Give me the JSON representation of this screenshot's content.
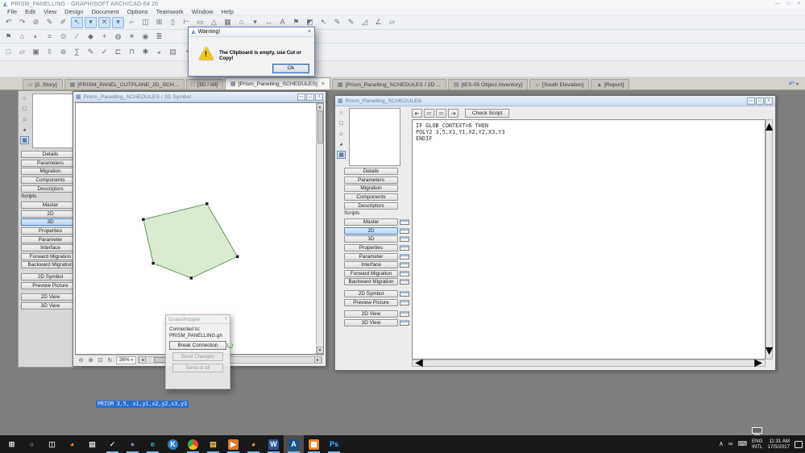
{
  "app": {
    "title": "PRISM_PANELLING - GRAPHISOFT ARCHICAD-64 20",
    "menu": [
      {
        "n": "menu-file",
        "label": "File"
      },
      {
        "n": "menu-edit",
        "label": "Edit"
      },
      {
        "n": "menu-view",
        "label": "View"
      },
      {
        "n": "menu-design",
        "label": "Design"
      },
      {
        "n": "menu-document",
        "label": "Document"
      },
      {
        "n": "menu-options",
        "label": "Options"
      },
      {
        "n": "menu-teamwork",
        "label": "Teamwork"
      },
      {
        "n": "menu-window",
        "label": "Window"
      },
      {
        "n": "menu-help",
        "label": "Help"
      }
    ]
  },
  "ui_glyphs": {
    "min": "—",
    "max": "□",
    "close": "×",
    "caret": "▾",
    "up": "▲",
    "down": "▼",
    "left": "◄",
    "right": "►",
    "history": "↶"
  },
  "toolbars": {
    "row1": [
      {
        "n": "undo-icon",
        "g": "↶"
      },
      {
        "n": "redo-icon",
        "g": "↷"
      },
      {
        "n": "suspend-groups-icon",
        "g": "⊘"
      },
      {
        "n": "pick-up-parameters-icon",
        "g": "✎"
      },
      {
        "n": "inject-parameters-icon",
        "g": "✐"
      },
      {
        "n": "arrow-tool",
        "g": "↖",
        "sel": true
      },
      {
        "n": "arrow-tool-dropdown",
        "g": "▾",
        "sel": true
      },
      {
        "n": "marquee-tool",
        "g": "✕",
        "sel": true
      },
      {
        "n": "marquee-tool-dropdown",
        "g": "▾",
        "sel": true
      },
      {
        "n": "wall-tool",
        "g": "⌐"
      },
      {
        "n": "door-tool",
        "g": "◫"
      },
      {
        "n": "window-tool",
        "g": "⊞"
      },
      {
        "n": "column-tool",
        "g": "▯"
      },
      {
        "n": "beam-tool",
        "g": "⊢"
      },
      {
        "n": "slab-tool",
        "g": "▭"
      },
      {
        "n": "roof-tool",
        "g": "△"
      },
      {
        "n": "mesh-tool",
        "g": "▦"
      },
      {
        "n": "object-tool",
        "g": "⌂"
      },
      {
        "n": "object-tool-dropdown",
        "g": "▾"
      },
      {
        "n": "dimension-tool",
        "g": "↔"
      },
      {
        "n": "text-tool",
        "g": "A"
      },
      {
        "n": "label-tool",
        "g": "⚑"
      },
      {
        "n": "zone-tool",
        "g": "◩"
      },
      {
        "n": "pointer-3d-icon",
        "g": "↖",
        "c": "#3a76c4"
      },
      {
        "n": "pencil-black-icon",
        "g": "✎",
        "c": "#444444"
      },
      {
        "n": "pencil-red-icon",
        "g": "✎",
        "c": "#b03a2e"
      },
      {
        "n": "slope-icon",
        "g": "◿",
        "c": "#2e8b57"
      },
      {
        "n": "angle-icon",
        "g": "∠",
        "c": "#3a76c4"
      },
      {
        "n": "fill-tool",
        "g": "▱"
      }
    ],
    "row2": [
      {
        "n": "favorites-icon",
        "g": "⚑"
      },
      {
        "n": "home-story-icon",
        "g": "⌂"
      },
      {
        "n": "trace-reference-icon",
        "g": "◐"
      },
      {
        "n": "grid-snap-icon",
        "g": "⌗"
      },
      {
        "n": "gravity-icon",
        "g": "⊙"
      },
      {
        "n": "guide-lines-icon",
        "g": "∕"
      },
      {
        "n": "snap-points-icon",
        "g": "◆"
      },
      {
        "n": "coordinates-icon",
        "g": "+"
      },
      {
        "n": "globe-icon",
        "g": "◍"
      },
      {
        "n": "sun-icon",
        "g": "☀"
      },
      {
        "n": "camera-icon",
        "g": "◉"
      },
      {
        "n": "layers-icon",
        "g": "≣"
      }
    ],
    "row3": [
      {
        "n": "new-file-icon",
        "g": "□"
      },
      {
        "n": "open-file-icon",
        "g": "▱"
      },
      {
        "n": "save-icon",
        "g": "▣"
      },
      {
        "n": "publish-icon",
        "g": "⇪"
      },
      {
        "n": "find-select-icon",
        "g": "⊚"
      },
      {
        "n": "quantities-icon",
        "g": "∑"
      },
      {
        "n": "markup-icon",
        "g": "✎"
      },
      {
        "n": "review-icon",
        "g": "✓"
      },
      {
        "n": "ruler-icon",
        "g": "⊏"
      },
      {
        "n": "profile-icon",
        "g": "⊓"
      },
      {
        "n": "magic-wand-icon",
        "g": "✱"
      },
      {
        "n": "trace-icon",
        "g": "◒"
      },
      {
        "n": "worksheet-icon",
        "g": "▤"
      },
      {
        "n": "detail-icon",
        "g": "◔"
      },
      {
        "n": "paragraph-icon",
        "g": "¶"
      },
      {
        "n": "align-left-icon",
        "g": "≡"
      },
      {
        "n": "align-justify-icon",
        "g": "≣"
      },
      {
        "n": "spell-check-icon",
        "g": "✓"
      }
    ]
  },
  "tabbar": {
    "tabs": [
      {
        "n": "tab-2-story",
        "g": "▱",
        "label": "[2. Story]"
      },
      {
        "n": "tab-prism-panel-cutplane-2d-sch",
        "g": "▦",
        "label": "[PRISM_PANEL_CUTPLANE_2D_SCH..."
      },
      {
        "n": "tab-3d-all",
        "g": "□",
        "label": "[3D / All]"
      },
      {
        "n": "tab-prism-panelling-schedules",
        "g": "▦",
        "label": "[Prism_Panelling_SCHEDULES]",
        "active": true,
        "x": "×"
      },
      {
        "n": "tab-prism-panelling-schedules-2d",
        "g": "▦",
        "label": "[Prism_Panelling_SCHEDULES / 2D ..."
      },
      {
        "n": "tab-ies-05-object-inventory",
        "g": "▤",
        "label": "[IES-05 Object Inventory]"
      },
      {
        "n": "tab-south-elevation",
        "g": "▱",
        "label": "[South Elevation]"
      },
      {
        "n": "tab-report",
        "g": "▲",
        "c": "#8f3a2e",
        "label": "[Report]"
      }
    ]
  },
  "strip_icons": [
    {
      "n": "hotspot-icon",
      "g": "○"
    },
    {
      "n": "rectangle-icon",
      "g": "□"
    },
    {
      "n": "lamp-icon",
      "g": "⌂"
    },
    {
      "n": "globe-icon",
      "g": "◕"
    },
    {
      "n": "grid-editor-icon",
      "g": "▦",
      "sel": true
    }
  ],
  "left_panel": {
    "items": [
      {
        "n": "sidebar-item-details",
        "label": "Details"
      },
      {
        "n": "sidebar-item-parameters",
        "label": "Parameters"
      },
      {
        "n": "sidebar-item-migration",
        "label": "Migration"
      },
      {
        "n": "sidebar-item-components",
        "label": "Components"
      },
      {
        "n": "sidebar-item-descriptors",
        "label": "Descriptors"
      },
      {
        "n": "scripts-section-label",
        "label": "Scripts",
        "header": true
      },
      {
        "n": "sidebar-item-master",
        "label": "Master"
      },
      {
        "n": "sidebar-item-2d",
        "label": "2D"
      },
      {
        "n": "sidebar-item-3d",
        "label": "3D",
        "sel": true
      },
      {
        "n": "sidebar-item-properties",
        "label": "Properties"
      },
      {
        "n": "sidebar-item-parameter",
        "label": "Parameter"
      },
      {
        "n": "sidebar-item-interface",
        "label": "Interface"
      },
      {
        "n": "sidebar-item-forward-migration",
        "label": "Forward Migration"
      },
      {
        "n": "sidebar-item-backward-migration",
        "label": "Backward Migration"
      },
      {
        "n": "sidebar-item-2d-symbol",
        "label": "2D Symbol",
        "gap": true
      },
      {
        "n": "sidebar-item-preview-picture",
        "label": "Preview Picture"
      },
      {
        "n": "sidebar-item-2d-view",
        "label": "2D View",
        "gap": true
      },
      {
        "n": "sidebar-item-3d-view",
        "label": "3D View"
      }
    ]
  },
  "left_window": {
    "title": "Prism_Panelling_SCHEDULES / 2D Symbol",
    "zoom_level": "36%",
    "polygon_points": "159,122 196,186 140,212 94,194 82,141",
    "bottom_icons": [
      {
        "n": "zoom-out-icon",
        "g": "⊖"
      },
      {
        "n": "zoom-in-icon",
        "g": "⊕"
      },
      {
        "n": "fit-in-window-icon",
        "g": "⊡"
      },
      {
        "n": "refresh-icon",
        "g": "↻"
      }
    ]
  },
  "right_window": {
    "title": "Prism_Panelling_SCHEDULES",
    "check_script_label": "Check Script",
    "toolbar_icons": [
      {
        "n": "goto-line-icon",
        "g": "⇤"
      },
      {
        "n": "indent-icon",
        "g": "≔"
      },
      {
        "n": "outdent-icon",
        "g": "≕"
      },
      {
        "n": "wrap-icon",
        "g": "⇥"
      }
    ],
    "script_lines": [
      "IF GLOB_CONTEXT=6 THEN",
      "POLY2 3,5,X1,Y1,X2,Y2,X3,Y3",
      "ENDIF"
    ],
    "sidebar_items": [
      {
        "n": "sidebar-item-details",
        "label": "Details"
      },
      {
        "n": "sidebar-item-parameters",
        "label": "Parameters"
      },
      {
        "n": "sidebar-item-migration",
        "label": "Migration"
      },
      {
        "n": "sidebar-item-components",
        "label": "Components"
      },
      {
        "n": "sidebar-item-descriptors",
        "label": "Descriptors"
      },
      {
        "n": "scripts-section-label",
        "label": "Scripts",
        "header": true
      },
      {
        "n": "sidebar-item-master",
        "label": "Master",
        "toggle": true
      },
      {
        "n": "sidebar-item-2d",
        "label": "2D",
        "sel": true,
        "toggle": true
      },
      {
        "n": "sidebar-item-3d",
        "label": "3D",
        "toggle": true
      },
      {
        "n": "sidebar-item-properties",
        "label": "Properties",
        "toggle": true
      },
      {
        "n": "sidebar-item-parameter",
        "label": "Parameter",
        "toggle": true
      },
      {
        "n": "sidebar-item-interface",
        "label": "Interface",
        "toggle": true
      },
      {
        "n": "sidebar-item-forward-migration",
        "label": "Forward Migration",
        "toggle": true
      },
      {
        "n": "sidebar-item-backward-migration",
        "label": "Backward Migration",
        "toggle": true
      },
      {
        "n": "sidebar-item-2d-symbol",
        "label": "2D Symbol",
        "gap": true,
        "toggle": true
      },
      {
        "n": "sidebar-item-preview-picture",
        "label": "Preview Picture",
        "toggle": true
      },
      {
        "n": "sidebar-item-2d-view",
        "label": "2D View",
        "gap": true,
        "toggle": true
      },
      {
        "n": "sidebar-item-3d-view",
        "label": "3D View",
        "toggle": true
      }
    ]
  },
  "grasshopper": {
    "title": "Grasshopper",
    "connected_line1": "Connected to:",
    "connected_line2": "PRISM_PANELLING.gh",
    "break_button": "Break Connection",
    "send_changes_button": "Send Changes",
    "send_all_button": "Send at all"
  },
  "dialog": {
    "title": "Warning!",
    "message": "The Clipboard is empty, use Cut or Copy!",
    "ok_label": "Ok"
  },
  "selection": {
    "text": "PRISM 3,5, x1,y1,x2,y2,x3,y3"
  },
  "taskbar": {
    "icons": [
      {
        "n": "start-button",
        "g": "⊞",
        "c": "#e8e8e8"
      },
      {
        "n": "search-button",
        "g": "○",
        "c": "#d8d8d8"
      },
      {
        "n": "task-view-button",
        "g": "◫",
        "c": "#d8d8d8"
      },
      {
        "n": "firefox-icon",
        "g": "◕",
        "c": "#ff8c2e"
      },
      {
        "n": "store-icon",
        "g": "▤",
        "c": "#dcdcdc"
      },
      {
        "n": "sketch-app-icon",
        "g": "✓",
        "c": "#cfcfcf",
        "u": true
      },
      {
        "n": "purple-app-icon",
        "g": "●",
        "c": "#8a7ab8",
        "u": true
      },
      {
        "n": "edge-icon",
        "g": "e",
        "c": "#35a3e8",
        "u": true
      },
      {
        "n": "k-app-icon",
        "g": "K",
        "c": "#ffffff",
        "bg": "#2e7fc2",
        "round": true
      },
      {
        "n": "chrome-icon",
        "g": "",
        "bg": "conic-gradient(#ea4335 0 33%, #fbbc05 33% 66%, #34a853 66% 100%)",
        "round": true,
        "u": true
      },
      {
        "n": "file-explorer-icon",
        "g": "▤",
        "c": "#f2c14e",
        "u": true
      },
      {
        "n": "media-app-icon",
        "g": "▶",
        "c": "#ffffff",
        "bg": "#d97b2c",
        "u": true
      },
      {
        "n": "firefox-nightly-icon",
        "g": "◕",
        "c": "#ff9e2e",
        "u": true
      },
      {
        "n": "word-icon",
        "g": "W",
        "c": "#ffffff",
        "bg": "#2b579a",
        "u": true
      },
      {
        "n": "archicad-icon",
        "g": "A",
        "c": "#ffffff",
        "bg": "#174f8c",
        "u": true,
        "active": true
      },
      {
        "n": "calendar-app-icon",
        "g": "▦",
        "c": "#ffffff",
        "bg": "#e8862c",
        "u": true
      },
      {
        "n": "photoshop-icon",
        "g": "Ps",
        "c": "#4cb4ff",
        "bg": "#0d1d2c",
        "u": true
      }
    ],
    "tray": {
      "chevron": "∧",
      "link_glyph": "∞",
      "keyboard_glyph": "⌨",
      "lang_line1": "ENG",
      "lang_line2": "INTL",
      "time": "11:31 AM",
      "date": "17/5/2017"
    }
  }
}
